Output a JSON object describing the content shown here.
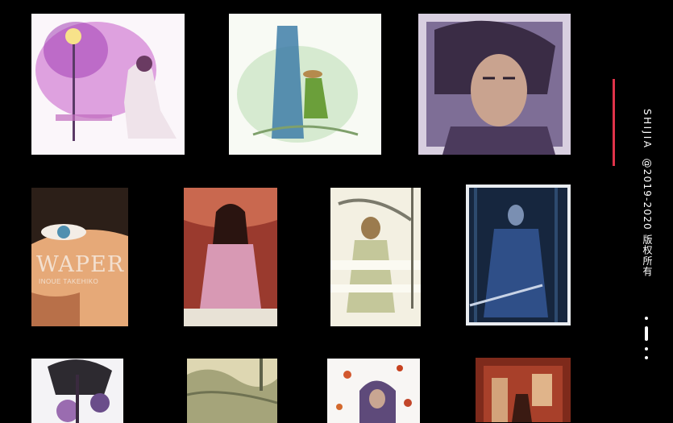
{
  "gallery": {
    "images": [
      {
        "id": "row1-1",
        "alt": "Watercolor of a figure writing by lamplight"
      },
      {
        "id": "row1-2",
        "alt": "Watercolor of a figure with straw hat by a tree"
      },
      {
        "id": "row1-3",
        "alt": "Painted portrait of a long-haired swordsman"
      },
      {
        "id": "row2-1",
        "alt": "Vagabond cover close-up eye"
      },
      {
        "id": "row2-2",
        "alt": "Seated figure in pink robe"
      },
      {
        "id": "row2-3",
        "alt": "Swordsman with wind-blown hair"
      },
      {
        "id": "row2-4",
        "alt": "Swordsman in dark bamboo forest"
      },
      {
        "id": "row3-1",
        "alt": "Two figures with dark ink"
      },
      {
        "id": "row3-2",
        "alt": "Landscape watercolor"
      },
      {
        "id": "row3-3",
        "alt": "Figure with falling leaves"
      },
      {
        "id": "row3-4",
        "alt": "Warm red painted scene"
      }
    ],
    "cover_title": "WAPER",
    "cover_subtitle": "INOUE TAKEHIKO"
  },
  "sidebar": {
    "brand": "SHIJIA",
    "copyright": "@2019-2020 版权所有"
  }
}
